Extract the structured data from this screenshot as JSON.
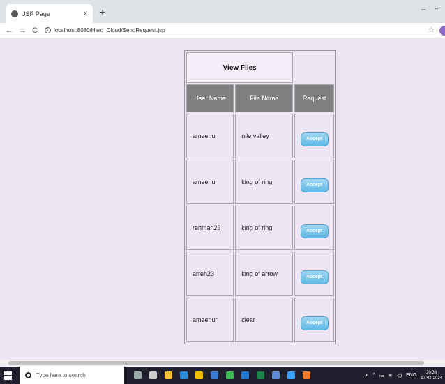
{
  "browser": {
    "tab_title": "JSP Page",
    "tab_close": "x",
    "new_tab": "+",
    "url": "localhost:8080/Hero_Cloud/SendRequest.jsp"
  },
  "page": {
    "title": "View Files",
    "columns": [
      "User Name",
      "File Name",
      "Request"
    ],
    "rows": [
      {
        "user": "ameenur",
        "file": "nile valley",
        "action": "Accept"
      },
      {
        "user": "ameenur",
        "file": "king of ring",
        "action": "Accept"
      },
      {
        "user": "rehman23",
        "file": "king of ring",
        "action": "Accept"
      },
      {
        "user": "arreh23",
        "file": "king of arrow",
        "action": "Accept"
      },
      {
        "user": "ameenur",
        "file": "clear",
        "action": "Accept"
      }
    ]
  },
  "taskbar": {
    "search_placeholder": "Type here to search",
    "language": "ENG",
    "time": "20:36",
    "date": "17-02-2024"
  },
  "colors": {
    "background": "#efe6f5",
    "header_row": "#808080",
    "accept_button": "#5fb8e4"
  }
}
